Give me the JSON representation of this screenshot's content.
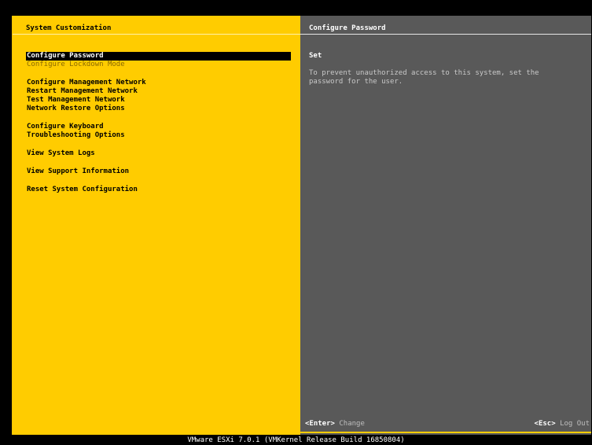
{
  "left_panel": {
    "title": "System Customization",
    "menu": {
      "configure_password": "Configure Password",
      "configure_lockdown_mode": "Configure Lockdown Mode",
      "configure_management_network": "Configure Management Network",
      "restart_management_network": "Restart Management Network",
      "test_management_network": "Test Management Network",
      "network_restore_options": "Network Restore Options",
      "configure_keyboard": "Configure Keyboard",
      "troubleshooting_options": "Troubleshooting Options",
      "view_system_logs": "View System Logs",
      "view_support_information": "View Support Information",
      "reset_system_configuration": "Reset System Configuration"
    }
  },
  "right_panel": {
    "title": "Configure Password",
    "status": "Set",
    "description": "To prevent unauthorized access to this system, set the\npassword for the user."
  },
  "footer": {
    "enter_key": "<Enter>",
    "enter_action": "Change",
    "esc_key": "<Esc>",
    "esc_action": "Log Out"
  },
  "version": "VMware ESXi 7.0.1 (VMKernel Release Build 16850804)",
  "colors": {
    "accent": "#FFCC00",
    "panel_gray": "#595959",
    "selection": "#000000"
  }
}
